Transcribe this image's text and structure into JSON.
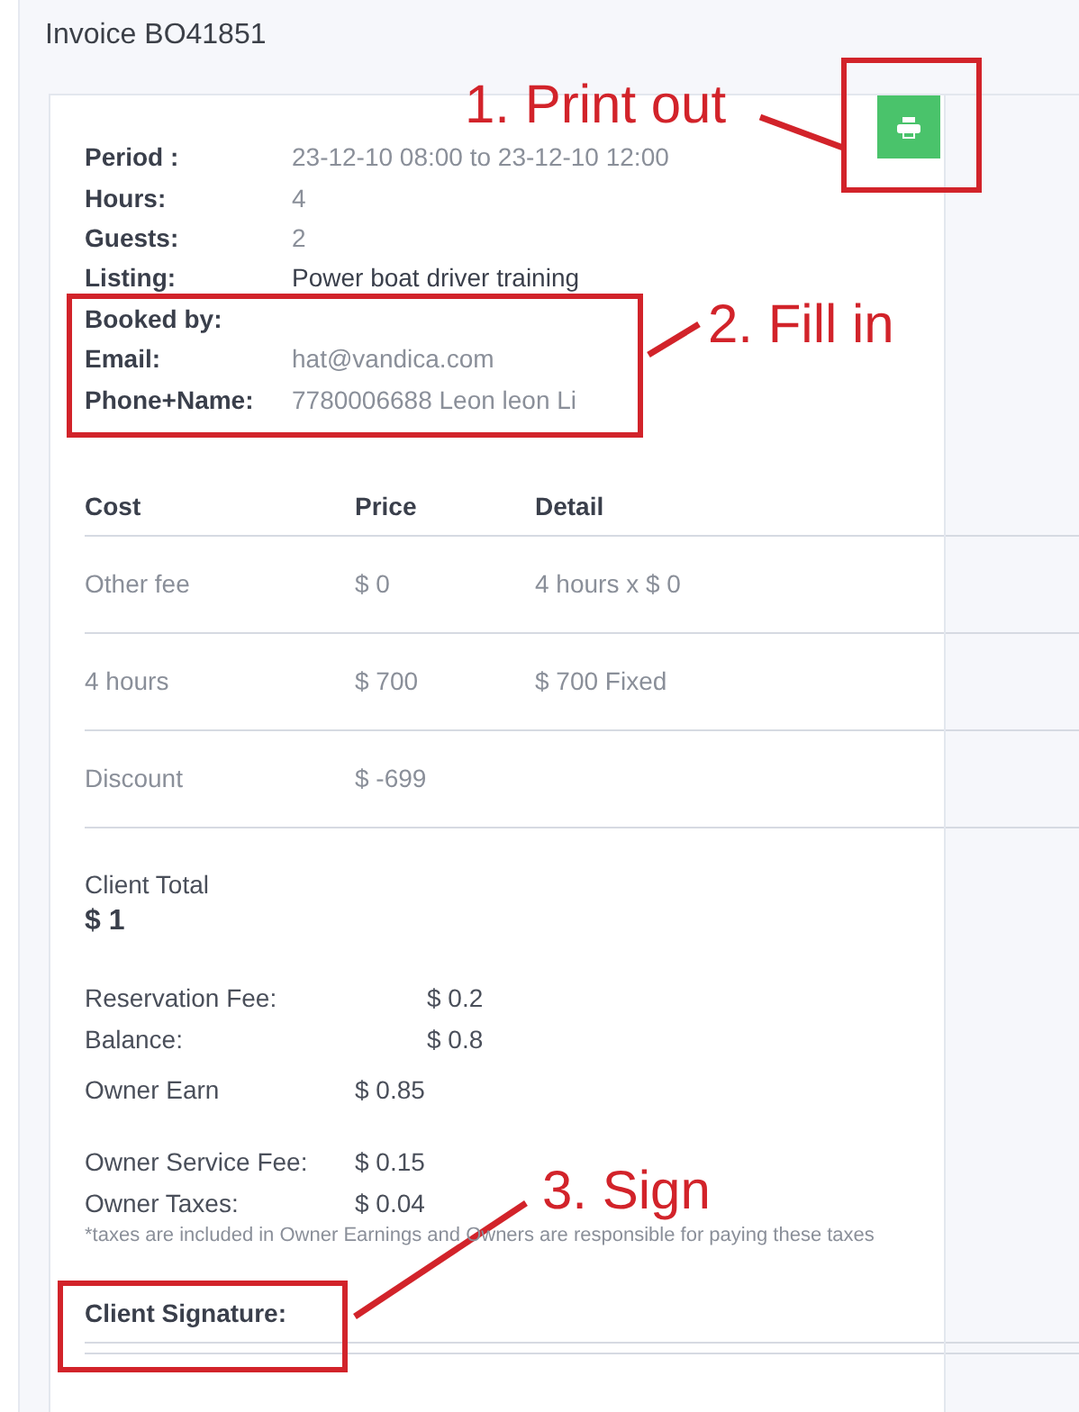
{
  "title": "Invoice BO41851",
  "details": [
    {
      "label": "Period :",
      "value": "23-12-10 08:00 to 23-12-10 12:00",
      "muted": true
    },
    {
      "label": "Hours:",
      "value": "4",
      "muted": true
    },
    {
      "label": "Guests:",
      "value": "2",
      "muted": true
    },
    {
      "label": "Listing:",
      "value": "Power boat driver training",
      "muted": false
    },
    {
      "label": "Booked by:"
    },
    {
      "label": "Email:",
      "value": "hat@vandica.com",
      "muted": true
    },
    {
      "label": "Phone+Name:",
      "value": "7780006688 Leon leon Li",
      "muted": true
    }
  ],
  "costs": {
    "columns": [
      "Cost",
      "Price",
      "Detail"
    ],
    "rows": [
      [
        "Other fee",
        "$ 0",
        "4 hours x $ 0"
      ],
      [
        "4 hours",
        "$ 700",
        "$ 700 Fixed"
      ],
      [
        "Discount",
        "$ -699"
      ]
    ]
  },
  "client_total": {
    "label": "Client Total",
    "value": "$ 1"
  },
  "payment": [
    {
      "label": "Reservation Fee:",
      "value": "$ 0.2"
    },
    {
      "label": "Balance:",
      "value": "$ 0.8"
    }
  ],
  "owner_earn": {
    "label": "Owner Earn",
    "value": "$ 0.85"
  },
  "owner_fees": [
    {
      "label": "Owner Service Fee:",
      "value": "$ 0.15"
    },
    {
      "label": "Owner Taxes:",
      "value": "$ 0.04"
    }
  ],
  "note": "*taxes are included in Owner Earnings and Owners are responsible for paying these taxes",
  "signature": {
    "label": "Client Signature:"
  },
  "annotations": [
    {
      "text": "1. Print out"
    },
    {
      "text": "2. Fill in"
    },
    {
      "text": "3. Sign"
    }
  ]
}
